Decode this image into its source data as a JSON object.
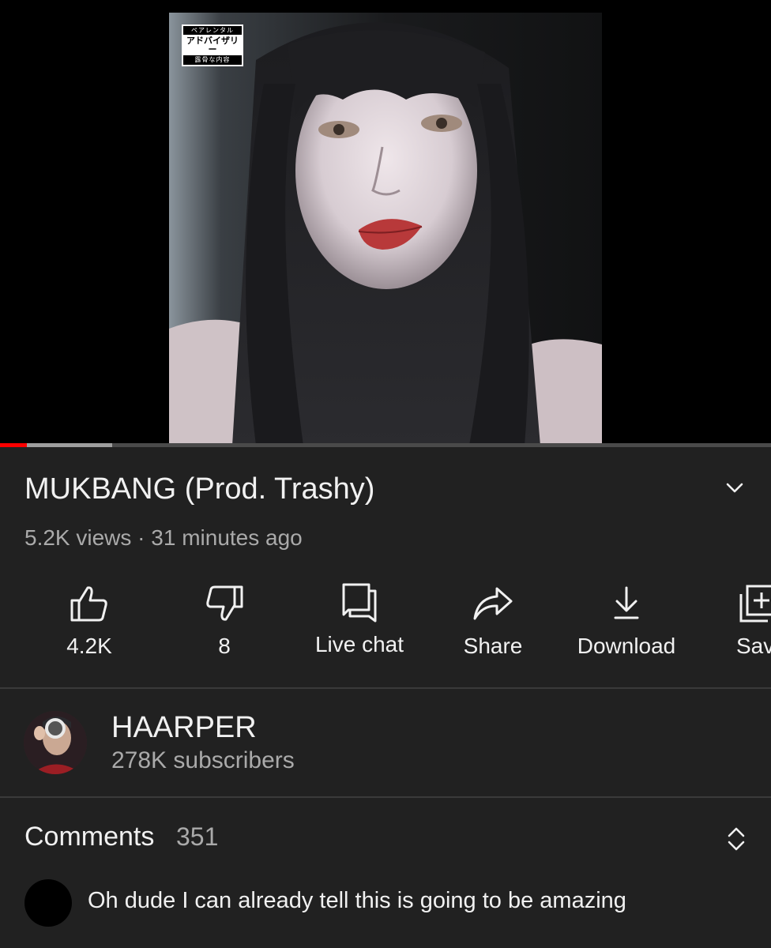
{
  "player": {
    "advisory": {
      "line1": "ペアレンタル",
      "line2": "アドバイザリー",
      "line3": "露骨な内容"
    },
    "progress": {
      "played_fraction": 0.035,
      "buffered_fraction": 0.145
    },
    "colors": {
      "played": "#ff0000",
      "buffered": "#9e9e9e",
      "track": "#4a4a4a"
    }
  },
  "video": {
    "title": "MUKBANG (Prod. Trashy)",
    "meta": "5.2K views · 31 minutes ago"
  },
  "actions": [
    {
      "id": "like",
      "icon": "thumbs-up-icon",
      "label": "4.2K"
    },
    {
      "id": "dislike",
      "icon": "thumbs-down-icon",
      "label": "8"
    },
    {
      "id": "live-chat",
      "icon": "live-chat-icon",
      "label": "Live chat"
    },
    {
      "id": "share",
      "icon": "share-arrow-icon",
      "label": "Share"
    },
    {
      "id": "download",
      "icon": "download-icon",
      "label": "Download"
    },
    {
      "id": "save",
      "icon": "playlist-add-icon",
      "label": "Sav"
    }
  ],
  "channel": {
    "name": "HAARPER",
    "subscribers": "278K subscribers"
  },
  "comments": {
    "title": "Comments",
    "count": "351",
    "first": {
      "text": "Oh dude I can already tell this is going to be amazing"
    }
  }
}
